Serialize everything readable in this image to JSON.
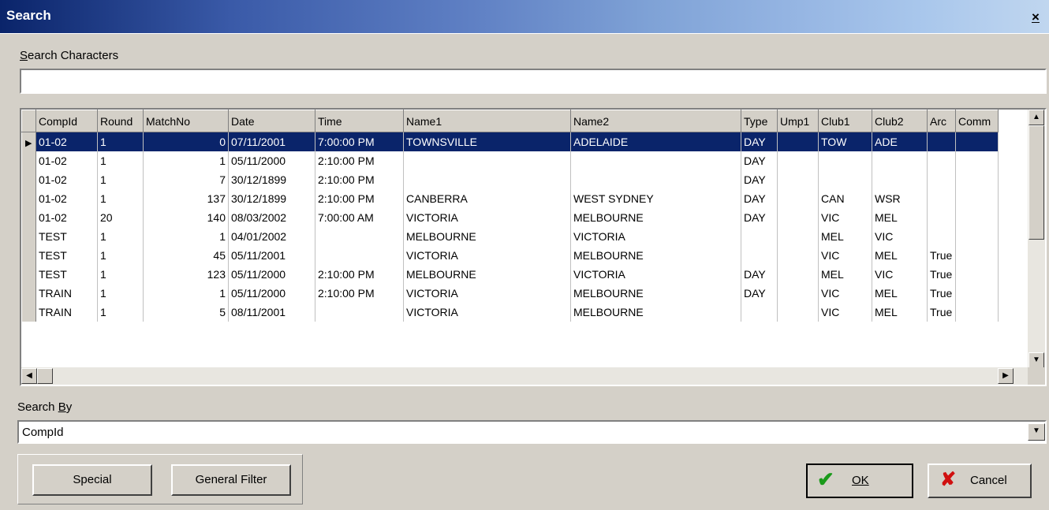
{
  "window": {
    "title": "Search",
    "close_glyph": "×"
  },
  "search": {
    "label": "Search Characters",
    "value": ""
  },
  "grid": {
    "columns": [
      "CompId",
      "Round",
      "MatchNo",
      "Date",
      "Time",
      "Name1",
      "Name2",
      "Type",
      "Ump1",
      "Club1",
      "Club2",
      "Arc",
      "Comm"
    ],
    "rows": [
      [
        "01-02",
        "1",
        "0",
        "07/11/2001",
        "7:00:00 PM",
        "TOWNSVILLE",
        "ADELAIDE",
        "DAY",
        "",
        "TOW",
        "ADE",
        "",
        ""
      ],
      [
        "01-02",
        "1",
        "1",
        "05/11/2000",
        "2:10:00 PM",
        "",
        "",
        "DAY",
        "",
        "",
        "",
        "",
        ""
      ],
      [
        "01-02",
        "1",
        "7",
        "30/12/1899",
        "2:10:00 PM",
        "",
        "",
        "DAY",
        "",
        "",
        "",
        "",
        ""
      ],
      [
        "01-02",
        "1",
        "137",
        "30/12/1899",
        "2:10:00 PM",
        "CANBERRA",
        "WEST SYDNEY",
        "DAY",
        "",
        "CAN",
        "WSR",
        "",
        ""
      ],
      [
        "01-02",
        "20",
        "140",
        "08/03/2002",
        "7:00:00 AM",
        "VICTORIA",
        "MELBOURNE",
        "DAY",
        "",
        "VIC",
        "MEL",
        "",
        ""
      ],
      [
        "TEST",
        "1",
        "1",
        "04/01/2002",
        "",
        "MELBOURNE",
        "VICTORIA",
        "",
        "",
        "MEL",
        "VIC",
        "",
        ""
      ],
      [
        "TEST",
        "1",
        "45",
        "05/11/2001",
        "",
        "VICTORIA",
        "MELBOURNE",
        "",
        "",
        "VIC",
        "MEL",
        "True",
        ""
      ],
      [
        "TEST",
        "1",
        "123",
        "05/11/2000",
        "2:10:00 PM",
        "MELBOURNE",
        "VICTORIA",
        "DAY",
        "",
        "MEL",
        "VIC",
        "True",
        ""
      ],
      [
        "TRAIN",
        "1",
        "1",
        "05/11/2000",
        "2:10:00 PM",
        "VICTORIA",
        "MELBOURNE",
        "DAY",
        "",
        "VIC",
        "MEL",
        "True",
        ""
      ],
      [
        "TRAIN",
        "1",
        "5",
        "08/11/2001",
        "",
        "VICTORIA",
        "MELBOURNE",
        "",
        "",
        "VIC",
        "MEL",
        "True",
        ""
      ]
    ],
    "selected_row": 0,
    "row_indicator_icon": "record-pointer-icon"
  },
  "search_by": {
    "label": "Search By",
    "value": "CompId"
  },
  "buttons": {
    "special": "Special",
    "general_filter": "General Filter",
    "ok": "OK",
    "cancel": "Cancel"
  },
  "colors": {
    "selection": "#0a246a",
    "ok_icon": "#1a9a1a",
    "cancel_icon": "#d01010",
    "face": "#d4d0c8"
  },
  "icons": {
    "ok": "checkmark-icon",
    "cancel": "x-icon"
  }
}
